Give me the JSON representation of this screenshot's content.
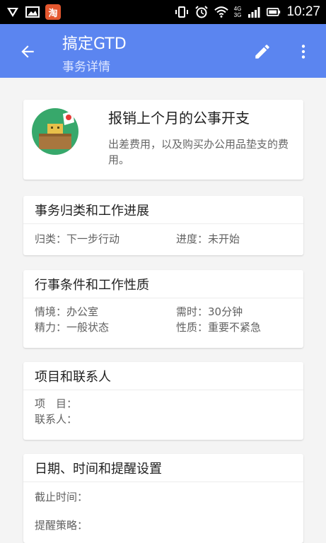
{
  "status_bar": {
    "taobao_char": "淘",
    "network_top": "4G",
    "network_bottom": "3G",
    "time": "10:27"
  },
  "app_bar": {
    "title": "搞定GTD",
    "subtitle": "事务详情",
    "accent_color": "#5b85f0"
  },
  "task": {
    "title": "报销上个月的公事开支",
    "description": "出差费用，以及购买办公用品垫支的费用。"
  },
  "sections": {
    "category": {
      "header": "事务归类和工作进展",
      "category": "归类：下一步行动",
      "progress": "进度：未开始"
    },
    "conditions": {
      "header": "行事条件和工作性质",
      "context": "情境：办公室",
      "time_needed": "需时：30分钟",
      "energy": "精力：一般状态",
      "nature": "性质：重要不紧急"
    },
    "project": {
      "header": "项目和联系人",
      "project": "项　目：",
      "contact": "联系人："
    },
    "dates": {
      "header": "日期、时间和提醒设置",
      "deadline": "截止时间：",
      "reminder": "提醒策略："
    }
  },
  "icons": [
    "back-arrow-icon",
    "edit-icon",
    "more-vert-icon"
  ]
}
